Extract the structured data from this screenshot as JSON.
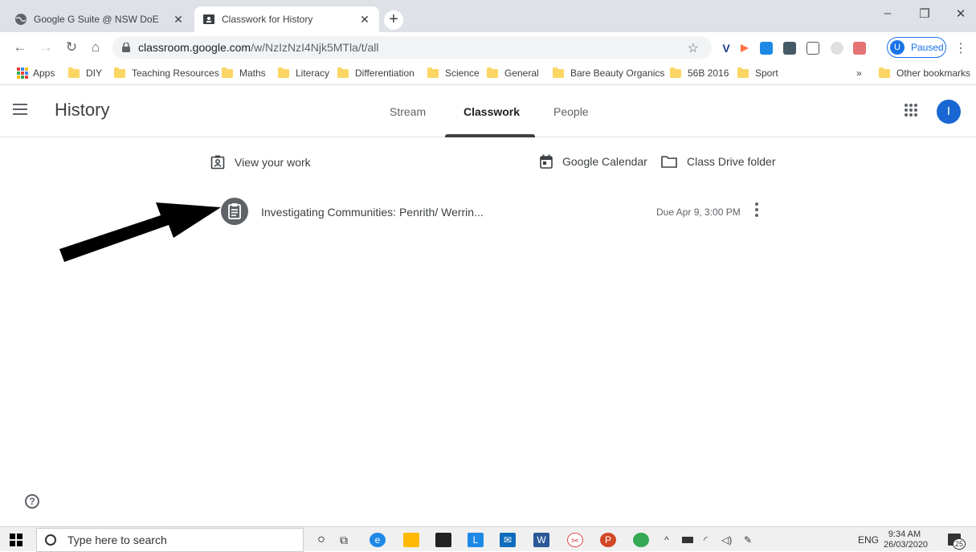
{
  "browser": {
    "tabs": [
      {
        "title": "Google G Suite @ NSW DoE",
        "icon": "globe-icon",
        "active": false
      },
      {
        "title": "Classwork for History",
        "icon": "classroom-icon",
        "active": true
      }
    ],
    "new_tab_label": "+",
    "window_controls": {
      "minimize": "–",
      "restore": "❐",
      "close": "✕"
    },
    "url_host": "classroom.google.com",
    "url_path": "/w/NzIzNzI4Njk5MTla/t/all",
    "profile_initial": "U",
    "profile_status": "Paused"
  },
  "bookmarks": [
    {
      "label": "Apps",
      "type": "apps"
    },
    {
      "label": "DIY",
      "type": "folder"
    },
    {
      "label": "Teaching Resources",
      "type": "folder"
    },
    {
      "label": "Maths",
      "type": "folder"
    },
    {
      "label": "Literacy",
      "type": "folder"
    },
    {
      "label": "Differentiation",
      "type": "folder"
    },
    {
      "label": "Science",
      "type": "folder"
    },
    {
      "label": "General",
      "type": "folder"
    },
    {
      "label": "Bare Beauty Organics",
      "type": "folder"
    },
    {
      "label": "56B 2016",
      "type": "folder"
    },
    {
      "label": "Sport",
      "type": "folder"
    }
  ],
  "bookmarks_overflow": "»",
  "other_bookmarks": "Other bookmarks",
  "classroom": {
    "class_name": "History",
    "tabs": [
      {
        "label": "Stream",
        "active": false
      },
      {
        "label": "Classwork",
        "active": true
      },
      {
        "label": "People",
        "active": false
      }
    ],
    "user_initial": "I",
    "view_work_label": "View your work",
    "calendar_label": "Google Calendar",
    "drive_label": "Class Drive folder",
    "assignment": {
      "title": "Investigating Communities: Penrith/ Werrin...",
      "due": "Due Apr 9, 3:00 PM"
    },
    "help_label": "?"
  },
  "taskbar": {
    "search_placeholder": "Type here to search",
    "language": "ENG",
    "time": "9:34 AM",
    "date": "26/03/2020",
    "notification_count": "25"
  },
  "colors": {
    "accent": "#1967d2",
    "tab_strip": "#dee1e6",
    "bookmark_folder": "#fcd664"
  }
}
